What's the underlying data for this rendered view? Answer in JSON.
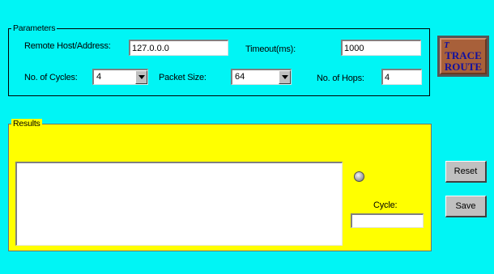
{
  "parameters": {
    "title": "Parameters",
    "remote_host": {
      "label": "Remote Host/Address:",
      "value": "127.0.0.0"
    },
    "timeout": {
      "label": "Timeout(ms):",
      "value": "1000"
    },
    "cycles": {
      "label": "No. of Cycles:",
      "value": "4"
    },
    "packet_size": {
      "label": "Packet Size:",
      "value": "64"
    },
    "hops": {
      "label": "No. of Hops:",
      "value": "4"
    }
  },
  "trace_button": {
    "mark": "T",
    "line1": "TRACE",
    "line2": "ROUTE"
  },
  "results": {
    "title": "Results",
    "cycle_label": "Cycle:",
    "cycle_value": ""
  },
  "buttons": {
    "reset": "Reset",
    "save": "Save"
  },
  "colors": {
    "background": "#00F5F5",
    "results_panel": "#FFFF00",
    "logo_face": "#A8603A",
    "logo_text": "#1010A0"
  },
  "icons": {
    "dropdown": "chevron-down-icon",
    "status": "status-led-icon",
    "logo": "trace-route-logo"
  }
}
